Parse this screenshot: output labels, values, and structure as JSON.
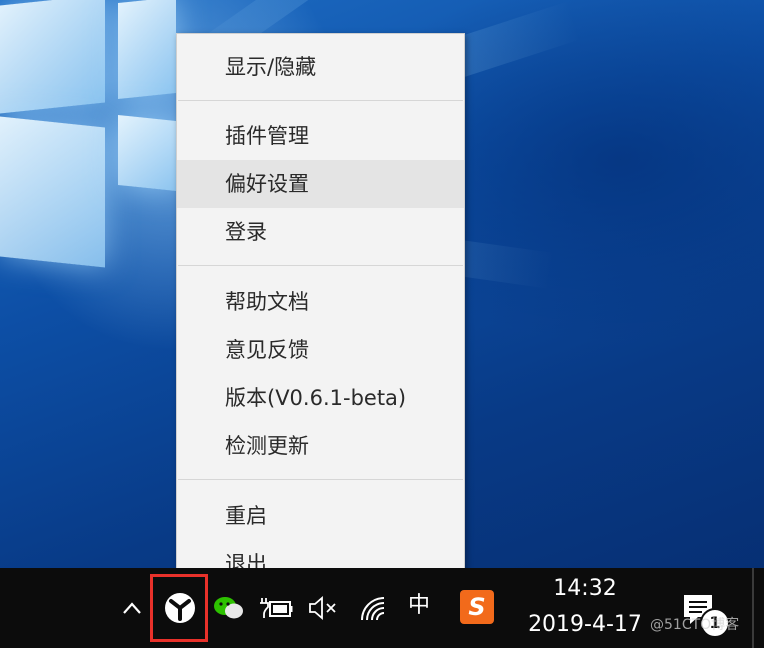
{
  "menu": {
    "items": [
      {
        "label": "显示/隐藏"
      },
      {
        "label": "插件管理"
      },
      {
        "label": "偏好设置"
      },
      {
        "label": "登录"
      },
      {
        "label": "帮助文档"
      },
      {
        "label": "意见反馈"
      },
      {
        "label": "版本(V0.6.1-beta)"
      },
      {
        "label": "检测更新"
      },
      {
        "label": "重启"
      },
      {
        "label": "退出"
      }
    ],
    "hovered_item": "偏好设置"
  },
  "taskbar": {
    "tray_icons": [
      "chevron-up-icon",
      "utools-tray-icon",
      "wechat-icon",
      "battery-charging-icon",
      "volume-muted-icon",
      "wifi-icon",
      "input-method-icon",
      "sogou-icon",
      "notification-icon"
    ],
    "ime_label": "中",
    "sogou_label": "S",
    "clock": {
      "time": "14:32",
      "date": "2019-4-17"
    },
    "notification_count": "1"
  },
  "watermark": "@51CTO博客",
  "colors": {
    "highlight_box": "#e8312a",
    "menu_bg": "#f3f3f3",
    "menu_hover": "#e4e4e4",
    "taskbar_bg": "#0c0c0c",
    "sogou_orange": "#f26a1b"
  }
}
